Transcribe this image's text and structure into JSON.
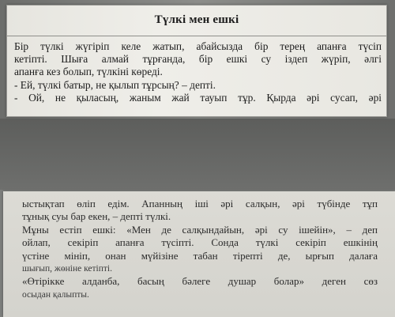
{
  "document": {
    "title": "Түлкі мен ешкі",
    "top_lines": [
      "Бір түлкі жүгіріп келе жатып, абайсызда бір терең апанға түсіп",
      "кетіпті. Шыға алмай тұрғанда, бір ешкі су іздеп жүріп, әлгі",
      "апанға кез болып, түлкіні көреді.",
      "- Ей, түлкі батыр, не қылып тұрсың? – депті.",
      "- Ой, не қыласың, жаным жай тауып тұр. Қырда әрі сусап, әрі"
    ],
    "bottom_lines": [
      "ыстықтап өліп едім. Апанның іші әрі салқын, әрі түбінде тұп",
      "тұнық суы бар екен, – депті түлкі.",
      "Мұны естіп ешкі: «Мен де салқындайын, әрі су ішейін», – деп",
      "ойлап, секіріп апанға түсіпті. Сонда түлкі секіріп ешкінің",
      "үстіне мініп, онан мүйізіне табан тірепті де, ырғып далаға",
      "шығып, жөніне кетіпті.",
      "«Өтірікке алданба, басың бәлеге душар болар» деген сөз",
      "осыдан қалыпты."
    ]
  }
}
